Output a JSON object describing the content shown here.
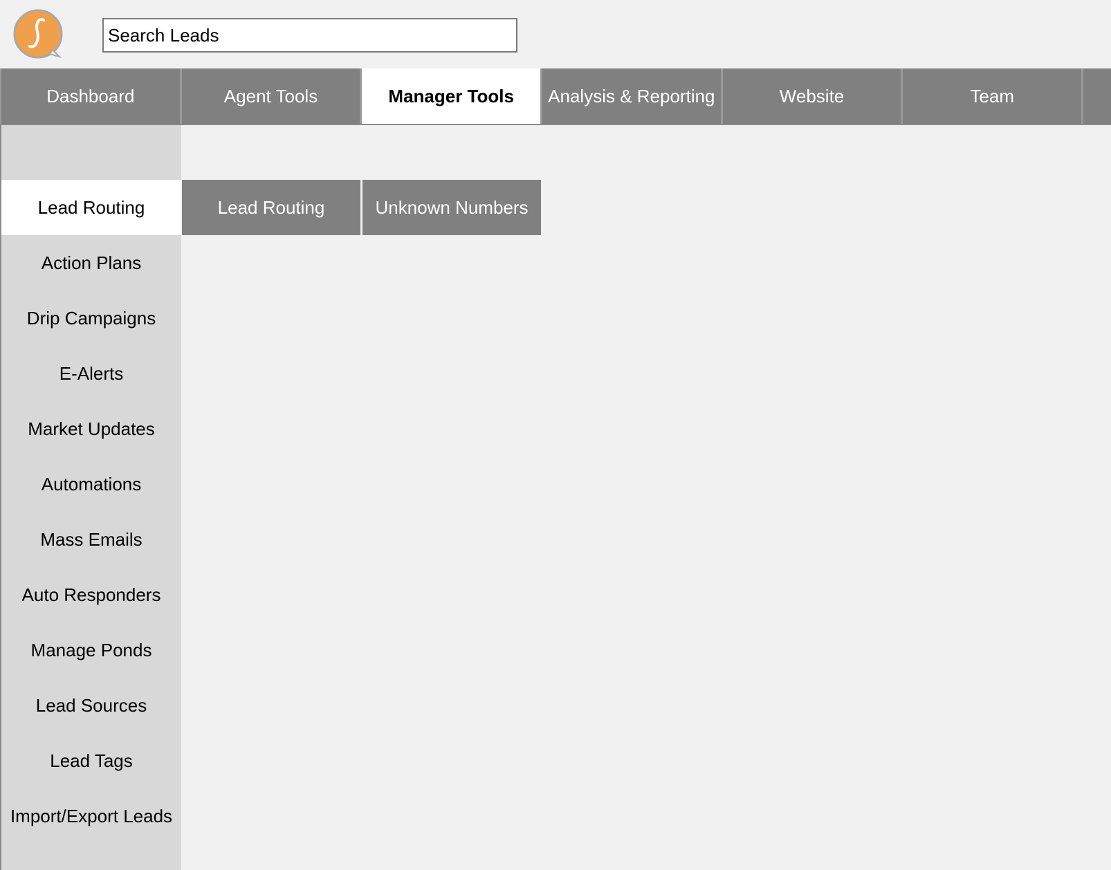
{
  "header": {
    "search_placeholder": "Search Leads",
    "logo_icon": "brand-logo-icon",
    "brand_color": "#f0a04b"
  },
  "top_nav": {
    "tabs": [
      {
        "label": "Dashboard",
        "active": false
      },
      {
        "label": "Agent Tools",
        "active": false
      },
      {
        "label": "Manager Tools",
        "active": true
      },
      {
        "label": "Analysis & Reporting",
        "active": false
      },
      {
        "label": "Website",
        "active": false
      },
      {
        "label": "Team",
        "active": false
      }
    ]
  },
  "sidebar": {
    "items": [
      {
        "label": "Lead Routing",
        "active": true
      },
      {
        "label": "Action Plans",
        "active": false
      },
      {
        "label": "Drip Campaigns",
        "active": false
      },
      {
        "label": "E-Alerts",
        "active": false
      },
      {
        "label": "Market Updates",
        "active": false
      },
      {
        "label": "Automations",
        "active": false
      },
      {
        "label": "Mass Emails",
        "active": false
      },
      {
        "label": "Auto Responders",
        "active": false
      },
      {
        "label": "Manage Ponds",
        "active": false
      },
      {
        "label": "Lead Sources",
        "active": false
      },
      {
        "label": "Lead Tags",
        "active": false
      },
      {
        "label": "Import/Export Leads",
        "active": false
      }
    ]
  },
  "sub_tabs": {
    "tabs": [
      {
        "label": "Lead Routing"
      },
      {
        "label": "Unknown Numbers"
      }
    ]
  },
  "colors": {
    "tab_background": "#808080",
    "sidebar_background": "#d8d8d8",
    "page_background": "#f1f1f1"
  }
}
